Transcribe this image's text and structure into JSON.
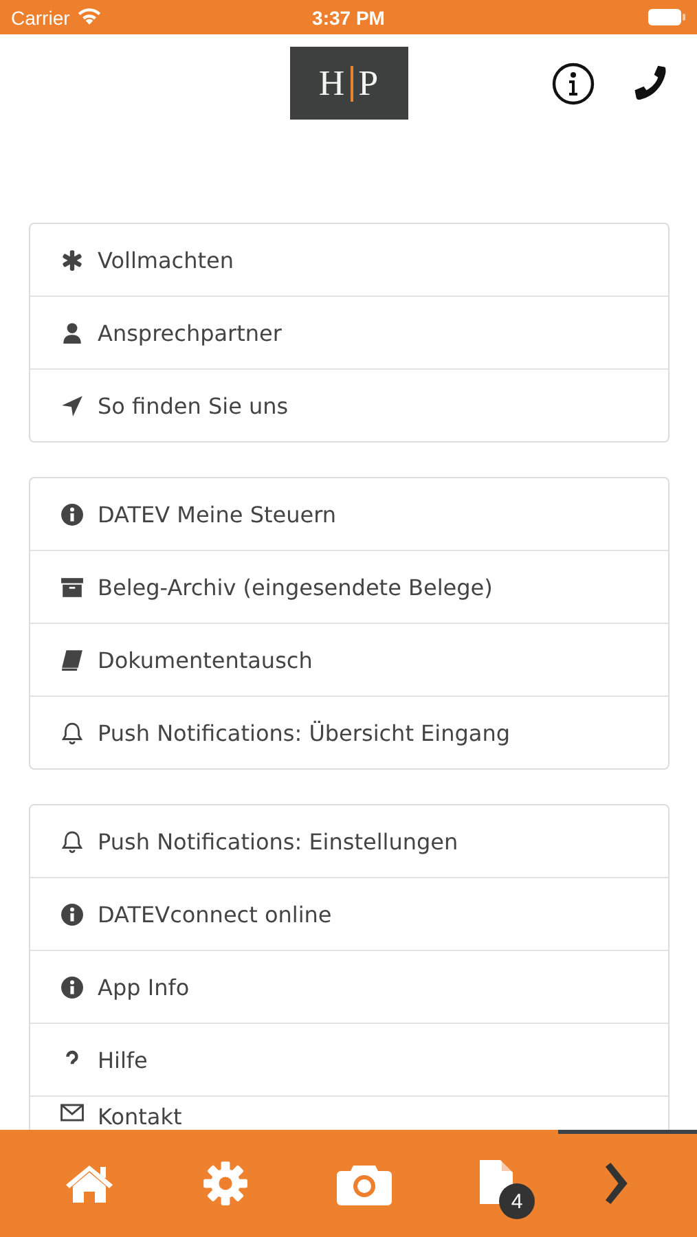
{
  "status_bar": {
    "carrier": "Carrier",
    "time": "3:37 PM"
  },
  "logo": {
    "left": "H",
    "right": "P"
  },
  "groups": [
    {
      "items": [
        {
          "label": "Vollmachten"
        },
        {
          "label": "Ansprechpartner"
        },
        {
          "label": "So finden Sie uns"
        }
      ]
    },
    {
      "items": [
        {
          "label": "DATEV Meine Steuern"
        },
        {
          "label": "Beleg-Archiv (eingesendete Belege)"
        },
        {
          "label": "Dokumententausch"
        },
        {
          "label": "Push Notifications: Übersicht Eingang"
        }
      ]
    },
    {
      "items": [
        {
          "label": "Push Notifications: Einstellungen"
        },
        {
          "label": "DATEVconnect online"
        },
        {
          "label": "App Info"
        },
        {
          "label": "Hilfe"
        },
        {
          "label": "Kontakt"
        }
      ]
    }
  ],
  "tab_bar": {
    "documents_badge": "4"
  }
}
